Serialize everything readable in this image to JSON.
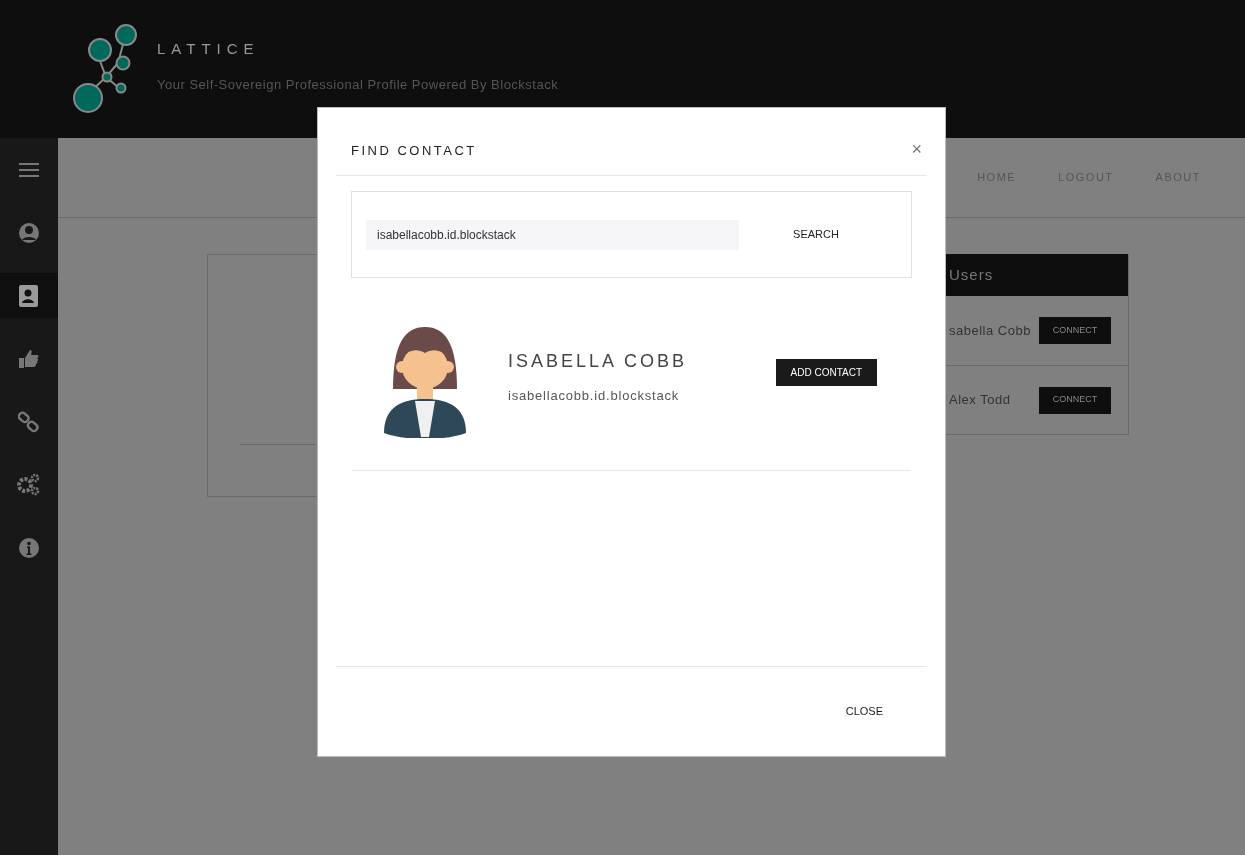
{
  "header": {
    "logo_text": "LATTICE",
    "tagline": "Your Self-Sovereign Professional Profile Powered By Blockstack"
  },
  "sidebar": {
    "items": [
      {
        "kind": "menu",
        "selected": false
      },
      {
        "kind": "profile",
        "selected": false
      },
      {
        "kind": "contacts",
        "selected": true
      },
      {
        "kind": "endorse",
        "selected": false
      },
      {
        "kind": "link",
        "selected": false
      },
      {
        "kind": "settings",
        "selected": false
      },
      {
        "kind": "info",
        "selected": false
      }
    ]
  },
  "nav": [
    "HOME",
    "LOGOUT",
    "ABOUT"
  ],
  "users_card": {
    "title": "Users",
    "rows": [
      {
        "name": "sabella Cobb",
        "button": "CONNECT"
      },
      {
        "name": "Alex Todd",
        "button": "CONNECT"
      }
    ]
  },
  "modal": {
    "title": "FIND CONTACT",
    "close_icon": "×",
    "search": {
      "value": "isabellacobb.id.blockstack",
      "button": "SEARCH"
    },
    "result": {
      "name": "ISABELLA COBB",
      "id": "isabellacobb.id.blockstack",
      "button": "ADD CONTACT"
    },
    "footer_button": "CLOSE"
  }
}
